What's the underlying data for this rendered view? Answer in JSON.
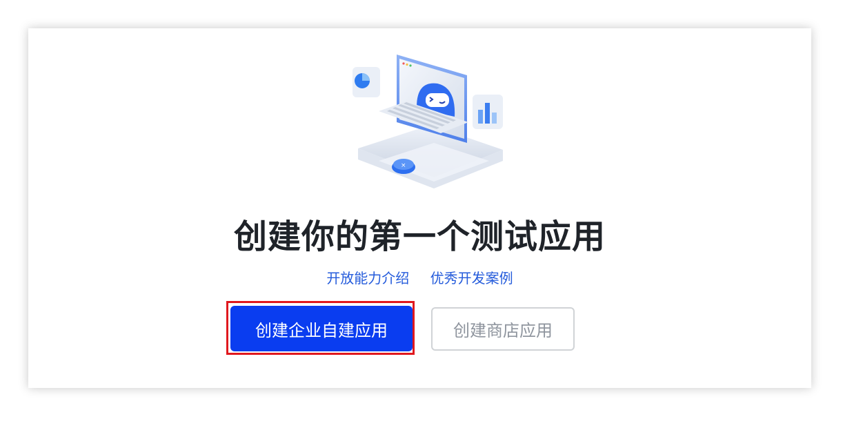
{
  "hero": {
    "title": "创建你的第一个测试应用"
  },
  "links": {
    "capability_intro": "开放能力介绍",
    "dev_cases": "优秀开发案例"
  },
  "actions": {
    "create_enterprise_app": "创建企业自建应用",
    "create_store_app": "创建商店应用"
  },
  "colors": {
    "primary": "#0a3df0",
    "link": "#245bdb",
    "highlight": "#e0181e",
    "title": "#1f2329"
  },
  "icons": {
    "hero_illustration": "robot-laptop-illustration"
  }
}
